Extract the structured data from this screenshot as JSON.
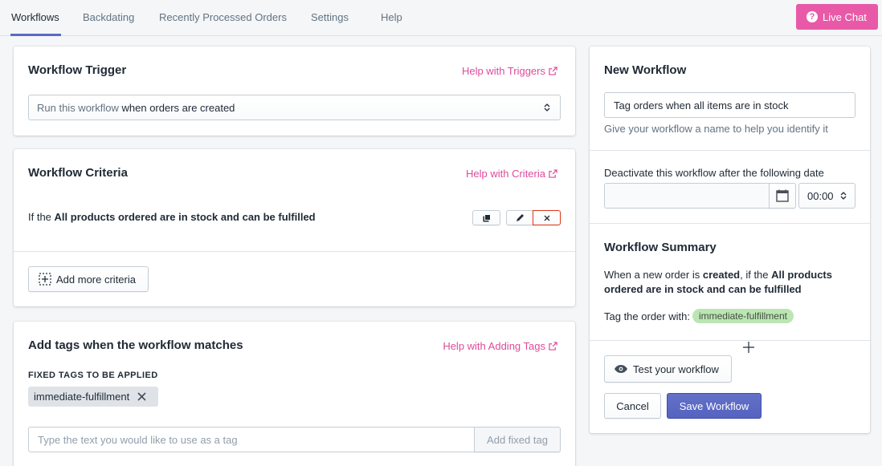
{
  "nav": {
    "tabs": [
      "Workflows",
      "Backdating",
      "Recently Processed Orders",
      "Settings",
      "Help"
    ],
    "live_chat": "Live Chat"
  },
  "trigger": {
    "title": "Workflow Trigger",
    "help": "Help with Triggers",
    "select_prefix": "Run this workflow",
    "select_value": "when orders are created"
  },
  "criteria": {
    "title": "Workflow Criteria",
    "help": "Help with Criteria",
    "row_prefix": "If the",
    "row_bold": "All products ordered are in stock and can be fulfilled",
    "add_more": "Add more criteria"
  },
  "tags": {
    "title": "Add tags when the workflow matches",
    "help": "Help with Adding Tags",
    "fixed_label": "FIXED TAGS TO BE APPLIED",
    "fixed_tag": "immediate-fulfillment",
    "input_placeholder": "Type the text you would like to use as a tag",
    "add_button": "Add fixed tag"
  },
  "new_workflow": {
    "title": "New Workflow",
    "name_value": "Tag orders when all items are in stock",
    "name_help": "Give your workflow a name to help you identify it",
    "deactivate_label": "Deactivate this workflow after the following date",
    "date_value": "",
    "time_value": "00:00"
  },
  "summary": {
    "title": "Workflow Summary",
    "line1_a": "When a new order is",
    "line1_b": "created",
    "line1_c": ", if the",
    "line1_d": "All products",
    "line2": "ordered are in stock and can be fulfilled",
    "tag_prefix": "Tag the order with:",
    "tag": "immediate-fulfillment",
    "test_button": "Test your workflow",
    "cancel_button": "Cancel",
    "save_button": "Save Workflow"
  }
}
